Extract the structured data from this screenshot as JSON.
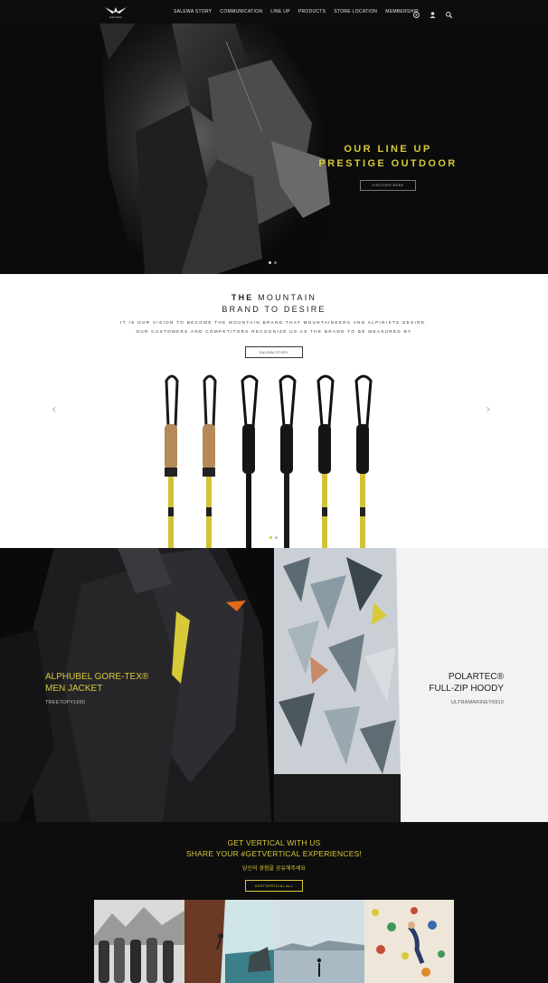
{
  "nav": {
    "logo_text": "SALEWA",
    "items": [
      {
        "label": "SALEWA STORY"
      },
      {
        "label": "COMMUNICATION"
      },
      {
        "label": "LINE UP"
      },
      {
        "label": "PRODUCTS"
      },
      {
        "label": "STORE LOCATION"
      },
      {
        "label": "MEMBERSHIP"
      }
    ],
    "icons": [
      "globe-icon",
      "user-icon",
      "search-icon"
    ]
  },
  "hero": {
    "title_line1": "OUR LINE UP",
    "title_line2": "PRESTIGE OUTDOOR",
    "button_label": "DISCOVER MORE",
    "accent_color": "#d8c93a"
  },
  "mountain": {
    "title_bold": "THE",
    "title_rest": " MOUNTAIN",
    "title_line2": "BRAND TO DESIRE",
    "desc_line1": "IT IS OUR VISION TO BECOME THE MOUNTAIN BRAND THAT MOUNTAINEERS AND ALPINISTS DESIRE.",
    "desc_line2": "OUR CUSTOMERS AND COMPETITORS RECOGNIZE US AS THE BRAND TO BE MEASURED BY",
    "button_label": "SALEWA STORY"
  },
  "products": [
    {
      "name_line1": "ALPHUBEL GORE-TEX®",
      "name_line2": "MEN JACKET",
      "code": "TREETOPY1650"
    },
    {
      "name_line1": "POLARTEC®",
      "name_line2": "FULL-ZIP HOODY",
      "code": "ULTRAMARINEY6910"
    }
  ],
  "social": {
    "line1": "GET VERTICAL WITH US",
    "line2": "SHARE YOUR #GETVERTICAL EXPERIENCES!",
    "korean": "당신의 경험을 공유해주세요",
    "button_label": "#GETVERTICAL ALL"
  }
}
